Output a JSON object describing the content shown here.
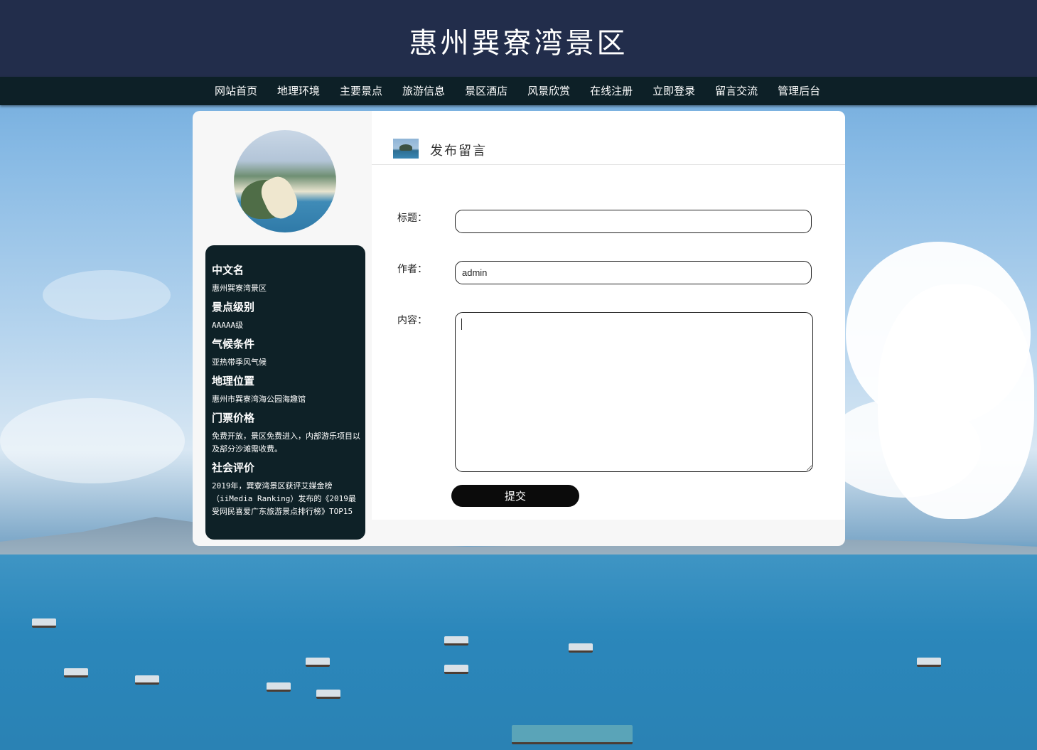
{
  "header": {
    "title": "惠州巽寮湾景区"
  },
  "nav": {
    "items": [
      "网站首页",
      "地理环境",
      "主要景点",
      "旅游信息",
      "景区酒店",
      "风景欣赏",
      "在线注册",
      "立即登录",
      "留言交流",
      "管理后台"
    ]
  },
  "sidebar": {
    "info": [
      {
        "label": "中文名",
        "value": "惠州巽寮湾景区"
      },
      {
        "label": "景点级别",
        "value": "AAAAA级"
      },
      {
        "label": "气候条件",
        "value": "亚热带季风气候"
      },
      {
        "label": "地理位置",
        "value": "惠州市巽寮湾海公园海趣馆"
      },
      {
        "label": "门票价格",
        "value": "免费开放，景区免费进入，内部游乐项目以及部分沙滩需收费。"
      },
      {
        "label": "社会评价",
        "value": "2019年，巽寮湾景区获评艾媒金榜（iiMedia Ranking）发布的《2019最受网民喜爱广东旅游景点排行榜》TOP15"
      }
    ]
  },
  "form": {
    "heading": "发布留言",
    "title_label": "标题：",
    "title_value": "",
    "author_label": "作者：",
    "author_value": "admin",
    "content_label": "内容：",
    "content_value": "",
    "submit_label": "提交"
  },
  "colors": {
    "header_bg": "#222d4b",
    "nav_bg": "#0d2027",
    "info_box_bg": "#0e2127",
    "button_bg": "#0b0b0b"
  }
}
